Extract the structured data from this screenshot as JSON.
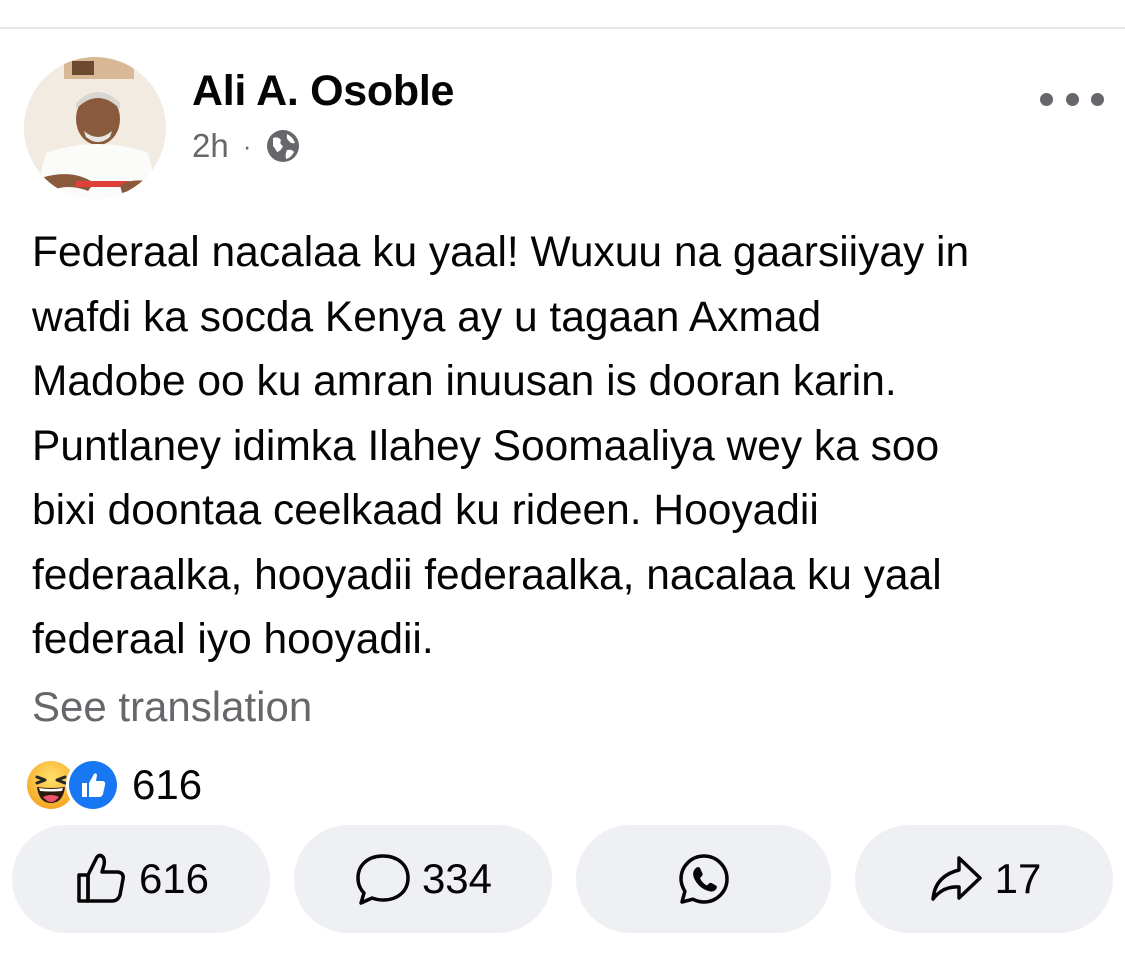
{
  "post": {
    "author": "Ali A. Osoble",
    "time": "2h",
    "separator": "·",
    "privacy_icon": "globe-icon",
    "text_lines": [
      "Federaal nacalaa ku yaal! Wuxuu na gaarsiiyay in",
      "wafdi ka socda Kenya ay u tagaan Axmad",
      "Madobe oo ku amran inuusan is dooran karin.",
      "Puntlaney idimka Ilahey Soomaaliya wey ka soo",
      "bixi doontaa ceelkaad ku rideen. Hooyadii",
      "federaalka, hooyadii federaalka, nacalaa ku yaal",
      "federaal iyo hooyadii."
    ],
    "see_translation": "See translation",
    "reactions": {
      "icons": [
        "haha-emoji-icon",
        "like-reaction-icon"
      ],
      "count": "616"
    }
  },
  "actions": {
    "like": {
      "icon": "thumbs-up-icon",
      "count": "616"
    },
    "comment": {
      "icon": "comment-bubble-icon",
      "count": "334"
    },
    "whatsapp": {
      "icon": "whatsapp-icon"
    },
    "share": {
      "icon": "share-arrow-icon",
      "count": "17"
    }
  },
  "colors": {
    "secondary_text": "#65676b",
    "button_bg": "#eff0f3",
    "like_blue": "#1877f2",
    "haha_yellow": "#f7b928"
  }
}
